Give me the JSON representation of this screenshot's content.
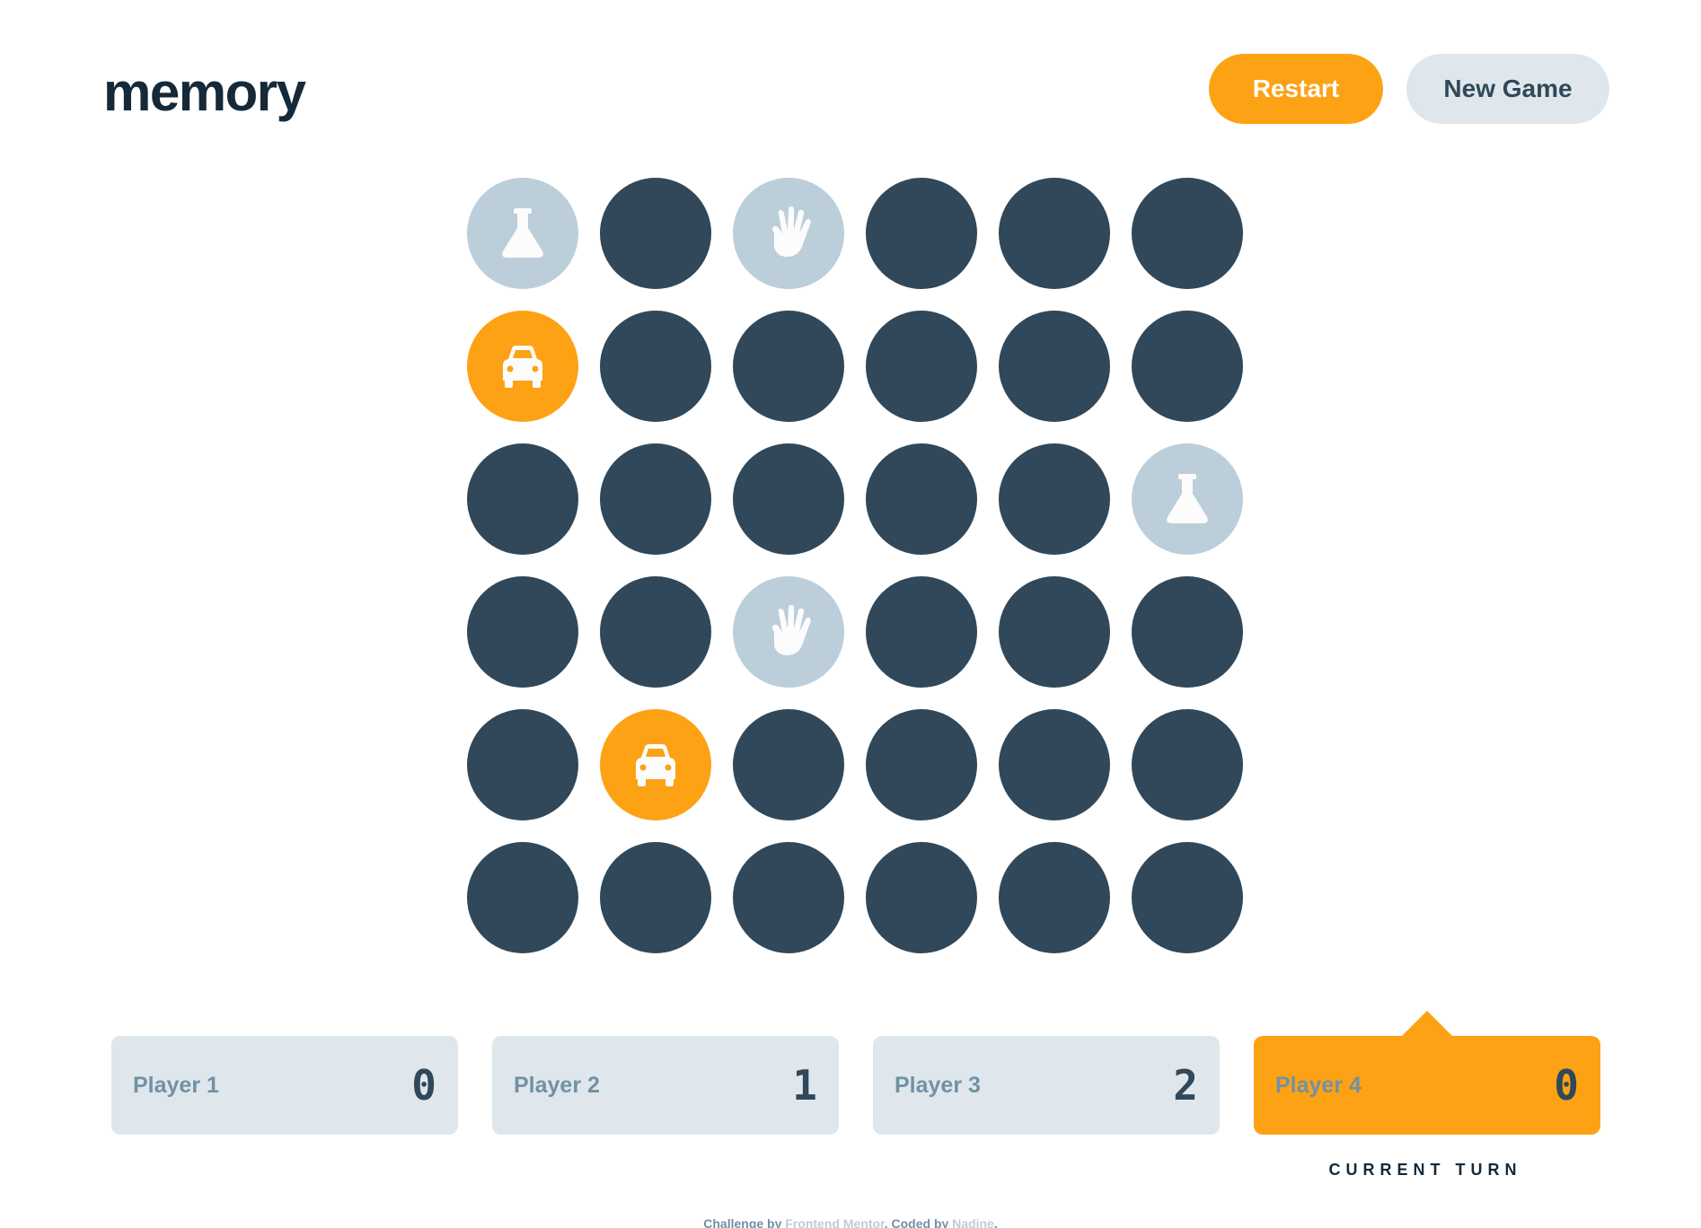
{
  "header": {
    "logo": "memory",
    "restart_label": "Restart",
    "new_game_label": "New Game"
  },
  "colors": {
    "hidden_tile": "#304859",
    "matched_tile": "#BCCED9",
    "revealed_tile": "#FDA214",
    "accent": "#FDA214",
    "dark_text": "#152938"
  },
  "board": {
    "columns": 6,
    "rows": 6,
    "tiles": [
      {
        "state": "matched",
        "icon": "flask-icon"
      },
      {
        "state": "hidden",
        "icon": ""
      },
      {
        "state": "matched",
        "icon": "hand-icon"
      },
      {
        "state": "hidden",
        "icon": ""
      },
      {
        "state": "hidden",
        "icon": ""
      },
      {
        "state": "hidden",
        "icon": ""
      },
      {
        "state": "revealed",
        "icon": "car-icon"
      },
      {
        "state": "hidden",
        "icon": ""
      },
      {
        "state": "hidden",
        "icon": ""
      },
      {
        "state": "hidden",
        "icon": ""
      },
      {
        "state": "hidden",
        "icon": ""
      },
      {
        "state": "hidden",
        "icon": ""
      },
      {
        "state": "hidden",
        "icon": ""
      },
      {
        "state": "hidden",
        "icon": ""
      },
      {
        "state": "hidden",
        "icon": ""
      },
      {
        "state": "hidden",
        "icon": ""
      },
      {
        "state": "hidden",
        "icon": ""
      },
      {
        "state": "matched",
        "icon": "flask-icon"
      },
      {
        "state": "hidden",
        "icon": ""
      },
      {
        "state": "hidden",
        "icon": ""
      },
      {
        "state": "matched",
        "icon": "hand-icon"
      },
      {
        "state": "hidden",
        "icon": ""
      },
      {
        "state": "hidden",
        "icon": ""
      },
      {
        "state": "hidden",
        "icon": ""
      },
      {
        "state": "hidden",
        "icon": ""
      },
      {
        "state": "revealed",
        "icon": "car-icon"
      },
      {
        "state": "hidden",
        "icon": ""
      },
      {
        "state": "hidden",
        "icon": ""
      },
      {
        "state": "hidden",
        "icon": ""
      },
      {
        "state": "hidden",
        "icon": ""
      },
      {
        "state": "hidden",
        "icon": ""
      },
      {
        "state": "hidden",
        "icon": ""
      },
      {
        "state": "hidden",
        "icon": ""
      },
      {
        "state": "hidden",
        "icon": ""
      },
      {
        "state": "hidden",
        "icon": ""
      },
      {
        "state": "hidden",
        "icon": ""
      }
    ]
  },
  "players": [
    {
      "name": "Player 1",
      "score": "0",
      "active": false
    },
    {
      "name": "Player 2",
      "score": "1",
      "active": false
    },
    {
      "name": "Player 3",
      "score": "2",
      "active": false
    },
    {
      "name": "Player 4",
      "score": "0",
      "active": true
    }
  ],
  "current_turn_label": "CURRENT TURN",
  "footer": {
    "prefix": "Challenge by ",
    "link1": "Frontend Mentor",
    "middle": ". Coded by ",
    "link2": "Nadine",
    "suffix": "."
  }
}
